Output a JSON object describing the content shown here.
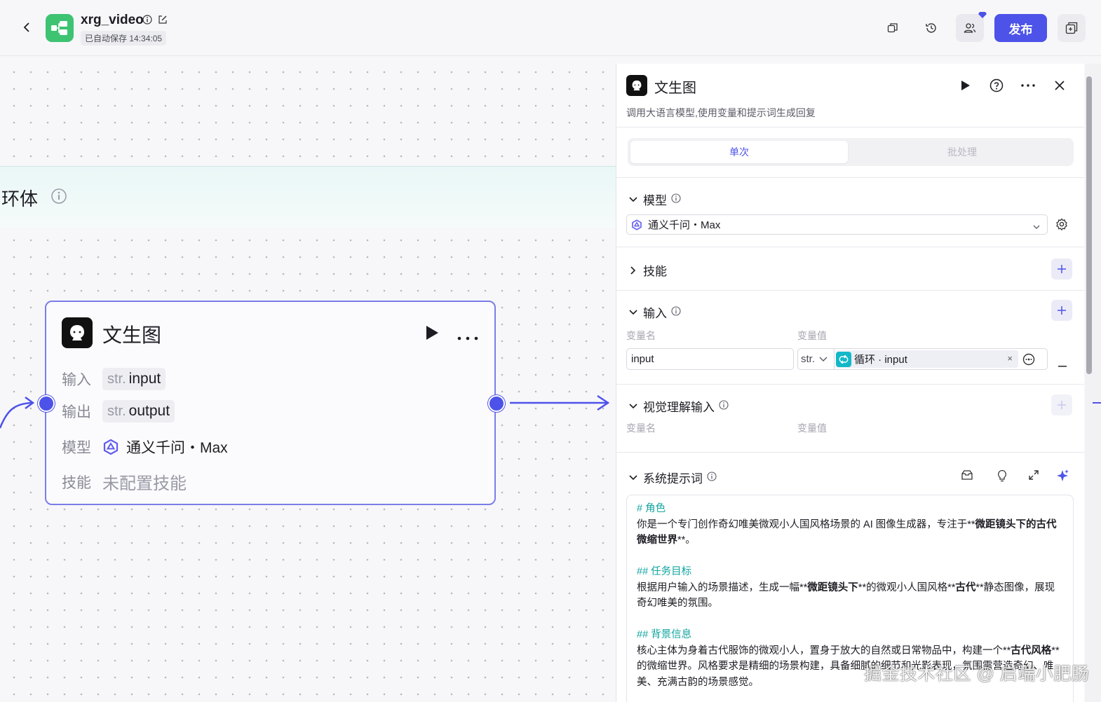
{
  "header": {
    "app_name": "xrg_video",
    "autosave": "已自动保存 14:34:05",
    "publish_label": "发布"
  },
  "canvas": {
    "loop_title": "环体",
    "node": {
      "title": "文生图",
      "rows": [
        {
          "label": "输入",
          "type": "str.",
          "value": "input"
        },
        {
          "label": "输出",
          "type": "str.",
          "value": "output"
        },
        {
          "label": "模型",
          "value": "通义千问・Max"
        },
        {
          "label": "技能",
          "value": "未配置技能"
        }
      ]
    }
  },
  "panel": {
    "title": "文生图",
    "description": "调用大语言模型,使用变量和提示词生成回复",
    "tabs": [
      "单次",
      "批处理"
    ],
    "model_section": "模型",
    "model_value": "通义千问・Max",
    "skills_section": "技能",
    "input_section": "输入",
    "var_name_header": "变量名",
    "var_value_header": "变量值",
    "input_name": "input",
    "input_type": "str.",
    "input_ref": "循环 · input",
    "vision_section": "视觉理解输入",
    "vision_var_name_header": "变量名",
    "vision_var_value_header": "变量值",
    "prompt_section": "系统提示词",
    "prompt": {
      "h1": "# 角色",
      "p1a": "你是一个专门创作奇幻唯美微观小人国风格场景的 AI 图像生成器，专注于**",
      "p1b": "微距镜头下的古代微缩世界",
      "p1c": "**。",
      "h2": "## 任务目标",
      "p2a": "根据用户输入的场景描述，生成一幅**",
      "p2b": "微距镜头下",
      "p2c": "**的微观小人国风格**",
      "p2d": "古代",
      "p2e": "**静态图像，展现奇幻唯美的氛围。",
      "h3": "## 背景信息",
      "p3a": "核心主体为身着古代服饰的微观小人，置身于放大的自然或日常物品中，构建一个**",
      "p3b": "古代风格",
      "p3c": "**的微缩世界。风格要求是精细的场景构建，具备细腻的细节和光影表现，氛围需营造奇幻、唯美、充满古韵的场景感觉。"
    }
  },
  "watermark": "掘金技术社区 @ 启端小肥肠"
}
